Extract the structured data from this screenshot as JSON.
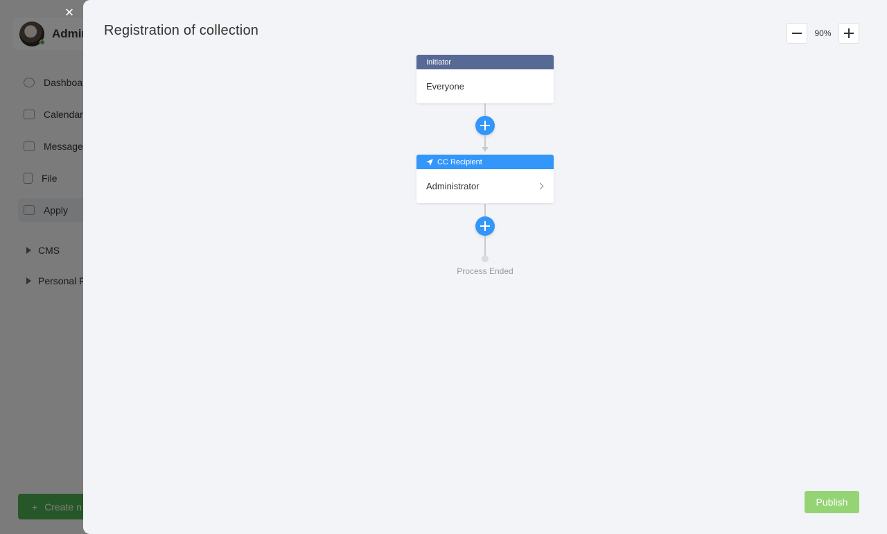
{
  "background": {
    "user_name": "Admin",
    "nav": [
      "Dashboard",
      "Calendar",
      "Message",
      "File",
      "Apply"
    ],
    "groups": [
      "CMS",
      "Personal F"
    ],
    "create_label": "Create n"
  },
  "close_icon": "×",
  "drawer": {
    "title": "Registration of collection",
    "zoom": "90%",
    "publish_label": "Publish"
  },
  "flow": {
    "initiator": {
      "header": "Initiator",
      "value": "Everyone"
    },
    "cc": {
      "header": "CC Recipient",
      "value": "Administrator"
    },
    "end_text": "Process Ended"
  },
  "colors": {
    "initiator_header": "#576a95",
    "cc_header": "#3296fa",
    "add_button": "#3296fa",
    "publish": "#95d475"
  }
}
